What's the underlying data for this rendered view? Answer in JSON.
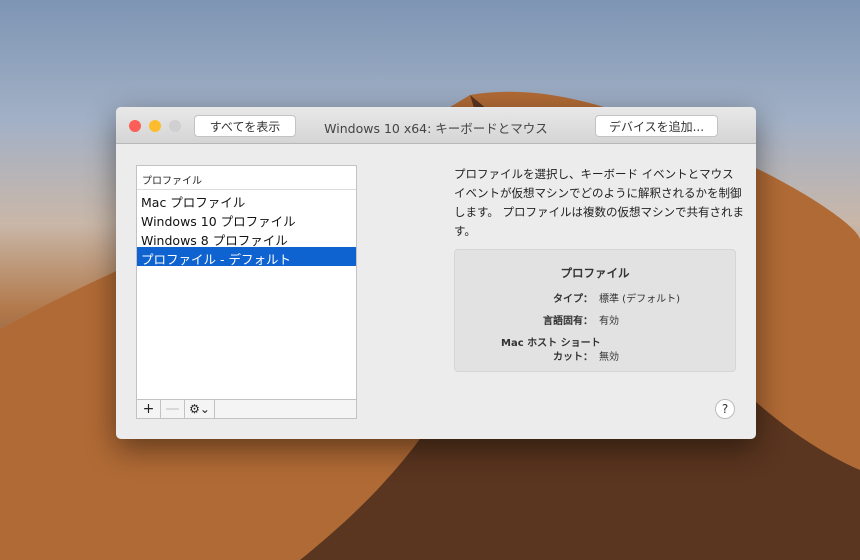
{
  "window": {
    "title": "Windows 10 x64: キーボードとマウス",
    "show_all": "すべてを表示",
    "add_device": "デバイスを追加..."
  },
  "list": {
    "header": "プロファイル",
    "items": [
      "Mac プロファイル",
      "Windows 10 プロファイル",
      "Windows 8 プロファイル",
      "プロファイル - デフォルト"
    ],
    "selected_index": 3,
    "tools": {
      "add": "+",
      "remove": "—",
      "gear": "⚙⌄"
    }
  },
  "description": "プロファイルを選択し、キーボード イベントとマウス イベントが仮想マシンでどのように解釈されるかを制御します。 プロファイルは複数の仮想マシンで共有されます。",
  "details": {
    "title": "プロファイル",
    "type_label": "タイプ：",
    "type_value": "標準 (デフォルト)",
    "lang_label": "言語固有：",
    "lang_value": "有効",
    "shortcut_label_1": "Mac ホスト ショート",
    "shortcut_label_2": "カット：",
    "shortcut_value": "無効"
  },
  "help": "?"
}
